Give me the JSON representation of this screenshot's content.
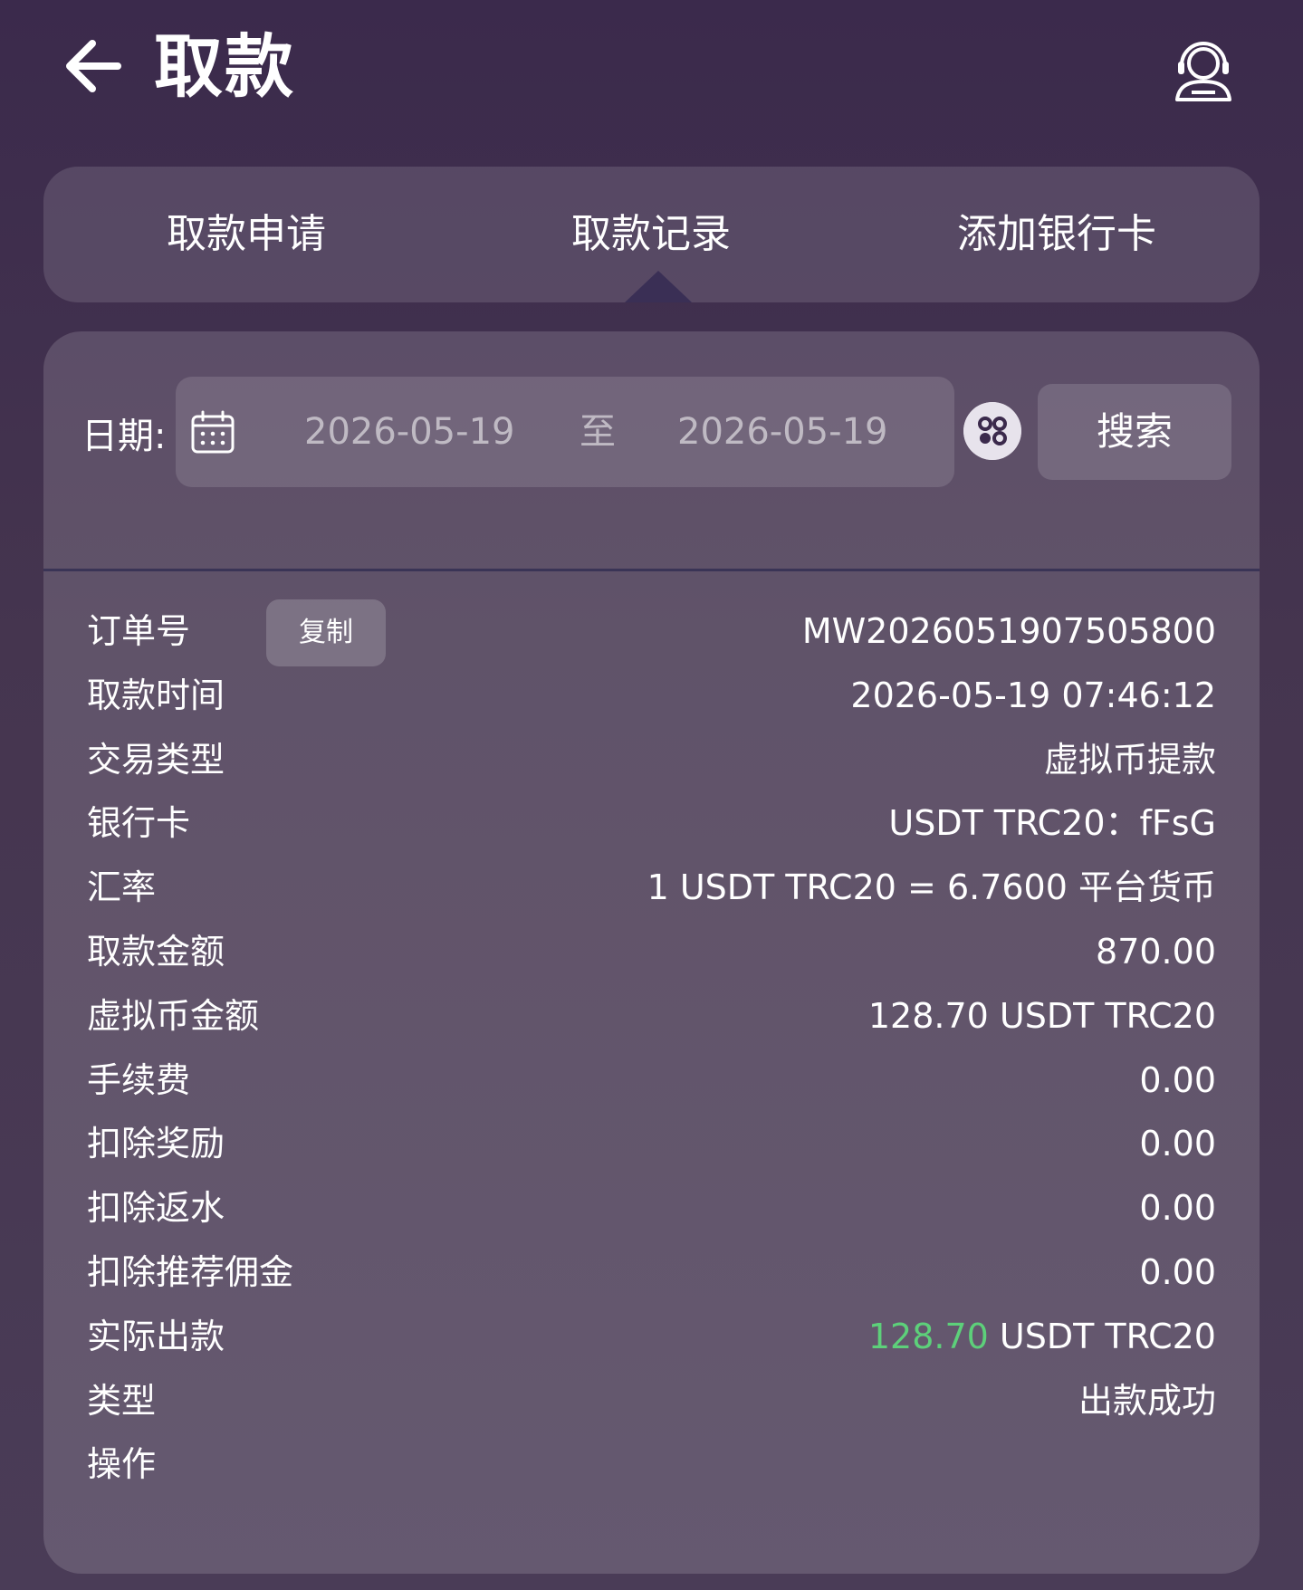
{
  "header": {
    "title": "取款"
  },
  "tabs": [
    {
      "label": "取款申请"
    },
    {
      "label": "取款记录"
    },
    {
      "label": "添加银行卡"
    }
  ],
  "active_tab": "取款记录",
  "filter": {
    "date_label": "日期:",
    "start_date": "2026-05-19",
    "separator": "至",
    "end_date": "2026-05-19",
    "search_label": "搜索"
  },
  "record": {
    "order_no_label": "订单号",
    "copy_label": "复制",
    "order_no": "MW2026051907505800",
    "time_label": "取款时间",
    "time": "2026-05-19 07:46:12",
    "type_label": "交易类型",
    "type": "虚拟币提款",
    "card_label": "银行卡",
    "card": "USDT TRC20：fFsG",
    "rate_label": "汇率",
    "rate": "1 USDT TRC20 = 6.7600 平台货币",
    "amount_label": "取款金额",
    "amount": "870.00",
    "crypto_amount_label": "虚拟币金额",
    "crypto_amount": "128.70 USDT TRC20",
    "fee_label": "手续费",
    "fee": "0.00",
    "deduct_bonus_label": "扣除奖励",
    "deduct_bonus": "0.00",
    "deduct_rebate_label": "扣除返水",
    "deduct_rebate": "0.00",
    "deduct_commission_label": "扣除推荐佣金",
    "deduct_commission": "0.00",
    "actual_label": "实际出款",
    "actual_value": "128.70",
    "actual_unit": " USDT TRC20",
    "status_label": "类型",
    "status": "出款成功",
    "action_label": "操作"
  },
  "colors": {
    "success": "#5dd07a",
    "background": "#3b2a4c"
  }
}
